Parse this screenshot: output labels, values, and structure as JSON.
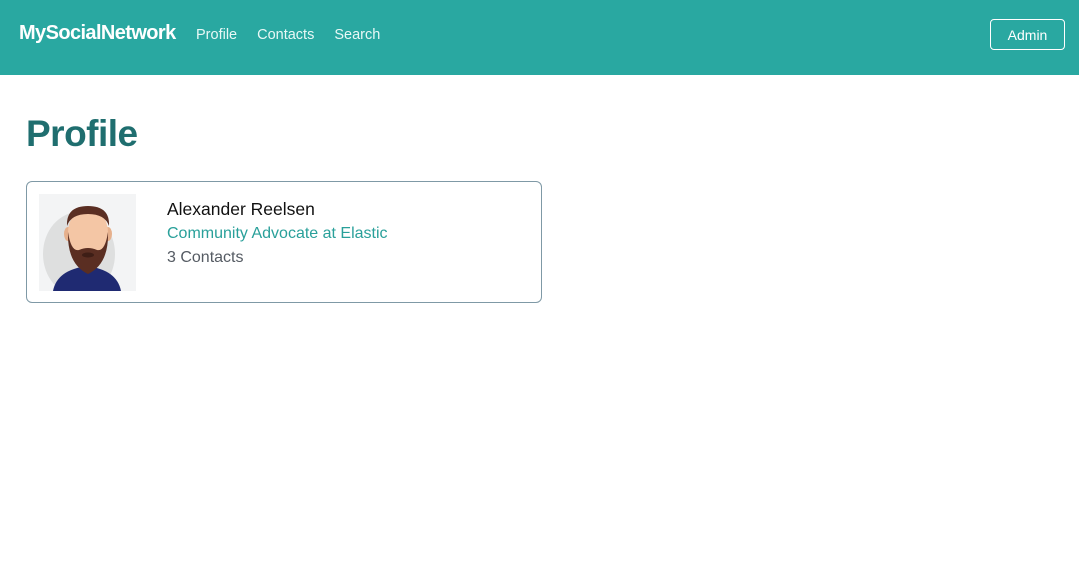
{
  "navbar": {
    "brand": "MySocialNetwork",
    "links": [
      {
        "label": "Profile"
      },
      {
        "label": "Contacts"
      },
      {
        "label": "Search"
      }
    ],
    "admin_label": "Admin"
  },
  "page": {
    "title": "Profile"
  },
  "profile_card": {
    "name": "Alexander Reelsen",
    "headline": "Community Advocate at Elastic",
    "contacts": "3 Contacts",
    "avatar_icon": "bearded-man-avatar-icon"
  },
  "colors": {
    "navbar_bg": "#29a8a1",
    "title": "#1f6e6f",
    "headline": "#29a09a"
  }
}
